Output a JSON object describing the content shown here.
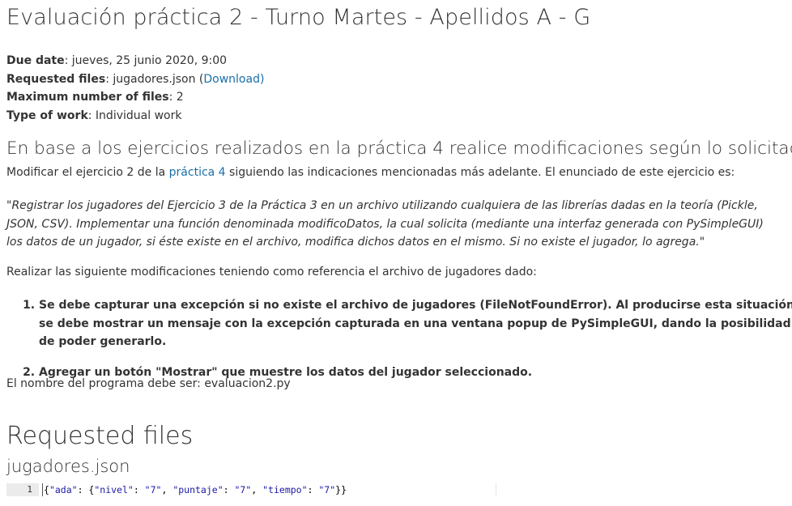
{
  "title": "Evaluación práctica 2 - Turno Martes - Apellidos A - G",
  "meta": {
    "due_label": "Due date",
    "due_value": ": jueves, 25 junio 2020, 9:00",
    "requested_label": "Requested files",
    "requested_value": ": jugadores.json (",
    "download_link": "Download",
    "requested_close": ")",
    "maxfiles_label": "Maximum number of files",
    "maxfiles_value": ": 2",
    "worktype_label": "Type of work",
    "worktype_value": ": Individual work"
  },
  "subtitle": "En base a los ejercicios realizados en la práctica 4 realice modificaciones según lo solicitado.",
  "para1": {
    "before": "Modificar el ejercicio 2 de la ",
    "link": "práctica 4",
    "after": " siguiendo las indicaciones mencionadas más adelante. El enunciado de este ejercicio es:"
  },
  "quote": "\"Registrar los jugadores del Ejercicio 3 de la Práctica 3 en un archivo utilizando cualquiera de las librerías dadas en la teoría (Pickle, JSON, CSV). Implementar una función denominada modificoDatos, la cual solicita (mediante una interfaz generada con PySimpleGUI) los datos de un jugador, si éste existe en el archivo, modifica dichos datos en el mismo. Si no existe el jugador, lo agrega.\"",
  "para2": "Realizar las siguiente modificaciones teniendo como referencia el archivo de jugadores dado:",
  "tasks": [
    "Se debe capturar una excepción si no existe el archivo de jugadores (FileNotFoundError). Al producirse esta situación se debe mostrar un mensaje con la excepción capturada en una ventana popup de PySimpleGUI, dando la posibilidad de poder generarlo.",
    "Agregar un botón \"Mostrar\" que muestre los datos del jugador seleccionado."
  ],
  "para3": "El nombre del programa debe ser: evaluacion2.py",
  "requested_heading": "Requested files",
  "file_heading": "jugadores.json",
  "code": {
    "line_number": "1",
    "text": "{\"ada\": {\"nivel\": \"7\", \"puntaje\": \"7\", \"tiempo\": \"7\"}}"
  },
  "colors": {
    "link": "#1a6fa8",
    "text": "#333333",
    "code_string": "#1a1aa6",
    "gutter_bg": "#ebebeb"
  }
}
